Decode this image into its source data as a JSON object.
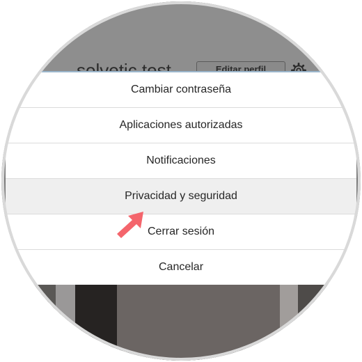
{
  "profile": {
    "username": "solvetic.test",
    "edit_profile_label": "Editar perfil"
  },
  "menu": {
    "items": [
      {
        "label": "Cambiar contraseña"
      },
      {
        "label": "Aplicaciones autorizadas"
      },
      {
        "label": "Notificaciones"
      },
      {
        "label": "Privacidad y seguridad",
        "highlighted": true
      },
      {
        "label": "Cerrar sesión"
      },
      {
        "label": "Cancelar"
      }
    ]
  },
  "icons": {
    "settings": "gear-icon",
    "pointer": "arrow-icon"
  },
  "colors": {
    "arrow": "#f4656c",
    "highlight_row": "#efefef",
    "overlay_tint": "#8e8e8e",
    "accent_line": "#9bb6cc"
  }
}
